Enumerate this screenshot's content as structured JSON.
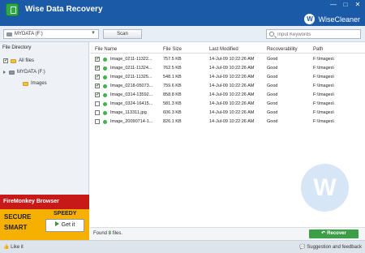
{
  "app": {
    "title": "Wise Data Recovery",
    "brand": "WiseCleaner",
    "window_controls": [
      "—",
      "□",
      "✕"
    ]
  },
  "toolbar": {
    "drive_select": "MYDATA (F:)",
    "scan_label": "Scan",
    "search_placeholder": "Input Keywords"
  },
  "sidebar": {
    "header": "File Directory",
    "items": [
      {
        "label": "All files",
        "checked": true
      },
      {
        "label": "MYDATA (F:)",
        "checked": false
      },
      {
        "label": "Images",
        "checked": false
      }
    ]
  },
  "promo": {
    "title": "FireMonkey Browser",
    "secure": "SECURE",
    "smart": "SMART",
    "speedy": "SPEEDY",
    "cta": "Get it"
  },
  "table": {
    "headers": [
      "File Name",
      "File Size",
      "Last Modified",
      "Recoverability",
      "Path"
    ],
    "rows": [
      {
        "checked": true,
        "name": "Image_0211-11322...",
        "size": "757.5 KB",
        "date": "14-Jul-09 10:22:26 AM",
        "recoverability": "Good",
        "path": "F:\\Images\\"
      },
      {
        "checked": true,
        "name": "Image_0211-11324...",
        "size": "762.5 KB",
        "date": "14-Jul-09 10:22:26 AM",
        "recoverability": "Good",
        "path": "F:\\Images\\"
      },
      {
        "checked": true,
        "name": "Image_0211-11325...",
        "size": "548.1 KB",
        "date": "14-Jul-09 10:22:26 AM",
        "recoverability": "Good",
        "path": "F:\\Images\\"
      },
      {
        "checked": true,
        "name": "Image_0218-05073...",
        "size": "759.6 KB",
        "date": "14-Jul-09 10:22:26 AM",
        "recoverability": "Good",
        "path": "F:\\Images\\"
      },
      {
        "checked": true,
        "name": "Image_0314-13592...",
        "size": "858.8 KB",
        "date": "14-Jul-09 10:22:26 AM",
        "recoverability": "Good",
        "path": "F:\\Images\\"
      },
      {
        "checked": false,
        "name": "Image_0324-16415...",
        "size": "581.3 KB",
        "date": "14-Jul-09 10:22:26 AM",
        "recoverability": "Good",
        "path": "F:\\Images\\"
      },
      {
        "checked": false,
        "name": "Image_113311.jpg",
        "size": "606.3 KB",
        "date": "14-Jul-09 10:22:26 AM",
        "recoverability": "Good",
        "path": "F:\\Images\\"
      },
      {
        "checked": false,
        "name": "Image_20090714-1...",
        "size": "826.1 KB",
        "date": "14-Jul-09 10:22:26 AM",
        "recoverability": "Good",
        "path": "F:\\Images\\"
      }
    ]
  },
  "footer": {
    "found_prefix": "Found",
    "found_count": "8",
    "found_suffix": "files.",
    "recover_label": "Recover"
  },
  "statusbar": {
    "like_it": "Like it",
    "suggestion": "Suggestion and feedback"
  },
  "colors": {
    "titlebar": "#1a5aa6",
    "accent_green": "#3c9e46",
    "sidebar_bg": "#eef2f6"
  },
  "icons": {
    "logo": "wise-data-recovery-logo-icon",
    "drive": "drive-icon",
    "search": "search-icon",
    "brand": "wisecleaner-w-icon",
    "folder": "folder-icon"
  }
}
